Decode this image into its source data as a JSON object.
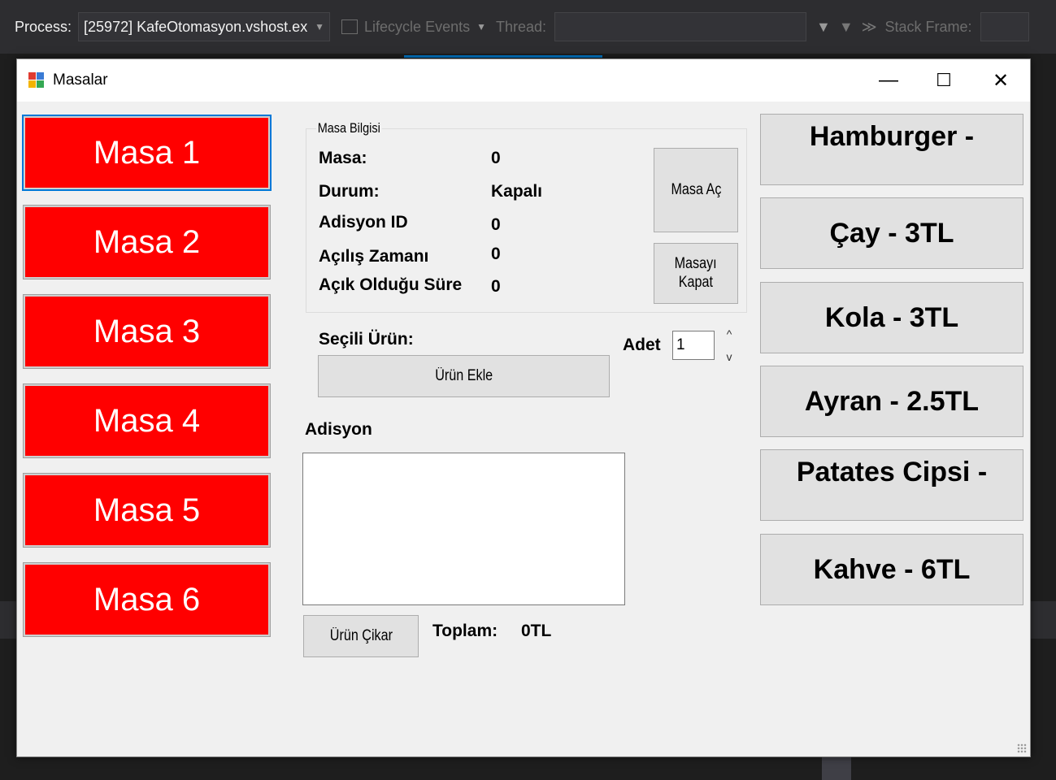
{
  "vs_toolbar": {
    "process_label": "Process:",
    "process_value": "[25972] KafeOtomasyon.vshost.exe",
    "lifecycle_label": "Lifecycle Events",
    "thread_label": "Thread:",
    "stack_frame_label": "Stack Frame:"
  },
  "window": {
    "title": "Masalar",
    "minimize": "—",
    "maximize": "☐",
    "close": "✕"
  },
  "tables": [
    {
      "label": "Masa 1",
      "selected": true
    },
    {
      "label": "Masa 2"
    },
    {
      "label": "Masa 3"
    },
    {
      "label": "Masa 4"
    },
    {
      "label": "Masa 5"
    },
    {
      "label": "Masa 6"
    }
  ],
  "masa_bilgisi": {
    "legend": "Masa Bilgisi",
    "masa_label": "Masa:",
    "masa_value": "0",
    "durum_label": "Durum:",
    "durum_value": "Kapalı",
    "adisyon_id_label": "Adisyon ID",
    "adisyon_id_value": "0",
    "acilis_label": "Açılış Zamanı",
    "acilis_value": "0",
    "sure_label": "Açık Olduğu Süre",
    "sure_value": "0",
    "masa_ac_button": "Masa Aç",
    "masayi_kapat_line1": "Masayı",
    "masayi_kapat_line2": "Kapat"
  },
  "order": {
    "secili_urun_label": "Seçili Ürün:",
    "adet_label": "Adet",
    "adet_value": "1",
    "urun_ekle_button": "Ürün Ekle",
    "adisyon_label": "Adisyon",
    "urun_cikar_button": "Ürün Çikar",
    "toplam_label": "Toplam:",
    "toplam_value": "0TL"
  },
  "products": [
    "Hamburger - ",
    "Çay - 3TL",
    "Kola - 3TL",
    "Ayran - 2.5TL",
    "Patates Cipsi - ",
    "Kahve - 6TL"
  ],
  "colors": {
    "table_button": "#ff0000",
    "vs_accent": "#007acc",
    "form_bg": "#f0f0f0"
  }
}
